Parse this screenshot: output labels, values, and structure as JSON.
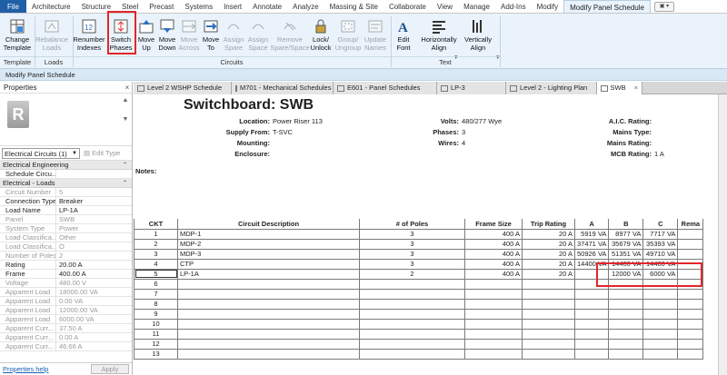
{
  "ribbon_tabs": [
    {
      "label": "File",
      "kind": "file"
    },
    {
      "label": "Architecture"
    },
    {
      "label": "Structure"
    },
    {
      "label": "Steel"
    },
    {
      "label": "Precast"
    },
    {
      "label": "Systems"
    },
    {
      "label": "Insert"
    },
    {
      "label": "Annotate"
    },
    {
      "label": "Analyze"
    },
    {
      "label": "Massing & Site"
    },
    {
      "label": "Collaborate"
    },
    {
      "label": "View"
    },
    {
      "label": "Manage"
    },
    {
      "label": "Add-Ins"
    },
    {
      "label": "Modify"
    },
    {
      "label": "Modify Panel Schedule",
      "kind": "ctx"
    }
  ],
  "tab_switch": "▣ ▾",
  "ribbon": {
    "buttons": [
      {
        "label": "Change\nTemplate",
        "icon": "change-template-icon",
        "enabled": true
      },
      {
        "label": "Rebalance\nLoads",
        "icon": "rebalance-loads-icon",
        "enabled": false
      },
      {
        "label": "Renumber\nIndexes",
        "icon": "renumber-indexes-icon",
        "enabled": true
      },
      {
        "label": "Switch\nPhases",
        "icon": "switch-phases-icon",
        "enabled": true
      },
      {
        "label": "Move\nUp",
        "icon": "move-up-icon",
        "enabled": true
      },
      {
        "label": "Move\nDown",
        "icon": "move-down-icon",
        "enabled": true
      },
      {
        "label": "Move\nAcross",
        "icon": "move-across-icon",
        "enabled": false
      },
      {
        "label": "Move\nTo",
        "icon": "move-to-icon",
        "enabled": true
      },
      {
        "label": "Assign\nSpare",
        "icon": "assign-spare-icon",
        "enabled": false
      },
      {
        "label": "Assign\nSpace",
        "icon": "assign-space-icon",
        "enabled": false
      },
      {
        "label": "Remove\nSpare/Space",
        "icon": "remove-spare-icon",
        "enabled": false
      },
      {
        "label": "Lock/\nUnlock",
        "icon": "lock-icon",
        "enabled": true
      },
      {
        "label": "Group/\nUngroup",
        "icon": "group-icon",
        "enabled": false
      },
      {
        "label": "Update\nNames",
        "icon": "update-names-icon",
        "enabled": false
      },
      {
        "label": "Edit\nFont",
        "icon": "edit-font-icon",
        "enabled": true
      },
      {
        "label": "Horizontally\nAlign",
        "icon": "horizontal-align-icon",
        "enabled": true
      },
      {
        "label": "Vertically\nAlign",
        "icon": "vertical-align-icon",
        "enabled": true
      }
    ],
    "groups": [
      {
        "label": "Template"
      },
      {
        "label": "Loads"
      },
      {
        "label": "Circuits"
      },
      {
        "label": "Text"
      }
    ]
  },
  "context_bar": "Modify Panel Schedule",
  "properties": {
    "title": "Properties",
    "close": "×",
    "type_selector": "Electrical Circuits (1)",
    "edit_type": "Edit Type",
    "categories": [
      {
        "label": "Electrical Engineering",
        "rows": [
          {
            "k": "Schedule Circu...",
            "v": "",
            "box": true
          }
        ]
      },
      {
        "label": "Electrical - Loads",
        "rows": [
          {
            "k": "Circuit Number",
            "v": "5",
            "ro": true
          },
          {
            "k": "Connection Type",
            "v": "Breaker"
          },
          {
            "k": "Load Name",
            "v": "LP-1A"
          },
          {
            "k": "Panel",
            "v": "SWB",
            "ro": true
          },
          {
            "k": "System Type",
            "v": "Power",
            "ro": true
          },
          {
            "k": "Load Classifica...",
            "v": "Other",
            "ro": true
          },
          {
            "k": "Load Classifica...",
            "v": "O",
            "ro": true
          },
          {
            "k": "Number of Poles",
            "v": "2",
            "ro": true
          },
          {
            "k": "Rating",
            "v": "20.00 A"
          },
          {
            "k": "Frame",
            "v": "400.00 A"
          },
          {
            "k": "Voltage",
            "v": "480.00 V",
            "ro": true
          },
          {
            "k": "Apparent Load",
            "v": "18000.00 VA",
            "ro": true
          },
          {
            "k": "Apparent Load",
            "v": "0.00 VA",
            "ro": true
          },
          {
            "k": "Apparent Load",
            "v": "12000.00 VA",
            "ro": true
          },
          {
            "k": "Apparent Load",
            "v": "6000.00 VA",
            "ro": true
          },
          {
            "k": "Apparent Curr...",
            "v": "37.50 A",
            "ro": true
          },
          {
            "k": "Apparent Curr...",
            "v": "0.00 A",
            "ro": true
          },
          {
            "k": "Apparent Curr...",
            "v": "46.66 A",
            "ro": true
          }
        ]
      }
    ],
    "help": "Properties help",
    "apply": "Apply"
  },
  "doc_tabs": [
    {
      "label": "Level 2 WSHP Schedule"
    },
    {
      "label": "M701 - Mechanical Schedules"
    },
    {
      "label": "E601 - Panel Schedules"
    },
    {
      "label": "LP-3"
    },
    {
      "label": "Level 2 - Lighting Plan"
    },
    {
      "label": "SWB",
      "active": true,
      "close": "×"
    }
  ],
  "schedule": {
    "title": "Switchboard: SWB",
    "header": {
      "left": [
        {
          "k": "Location:",
          "v": "Power Riser 113"
        },
        {
          "k": "Supply From:",
          "v": "T-SVC"
        },
        {
          "k": "Mounting:",
          "v": ""
        },
        {
          "k": "Enclosure:",
          "v": ""
        }
      ],
      "mid": [
        {
          "k": "Volts:",
          "v": "480/277 Wye"
        },
        {
          "k": "Phases:",
          "v": "3"
        },
        {
          "k": "Wires:",
          "v": "4"
        }
      ],
      "right": [
        {
          "k": "A.I.C. Rating:",
          "v": ""
        },
        {
          "k": "Mains Type:",
          "v": ""
        },
        {
          "k": "Mains Rating:",
          "v": ""
        },
        {
          "k": "MCB Rating:",
          "v": "1 A"
        }
      ]
    },
    "notes_label": "Notes:",
    "columns": [
      "CKT",
      "Circuit Description",
      "# of Poles",
      "Frame Size",
      "Trip Rating",
      "A",
      "B",
      "C",
      "Rema"
    ],
    "rows": [
      [
        "1",
        "MDP-1",
        "3",
        "400 A",
        "20 A",
        "5919 VA",
        "8977 VA",
        "7717 VA",
        ""
      ],
      [
        "2",
        "MDP-2",
        "3",
        "400 A",
        "20 A",
        "37471 VA",
        "35679 VA",
        "35393 VA",
        ""
      ],
      [
        "3",
        "MDP-3",
        "3",
        "400 A",
        "20 A",
        "50926 VA",
        "51351 VA",
        "49710 VA",
        ""
      ],
      [
        "4",
        "CTP",
        "3",
        "400 A",
        "20 A",
        "14400 VA",
        "14400 VA",
        "14400 VA",
        ""
      ],
      [
        "5",
        "LP-1A",
        "2",
        "400 A",
        "20 A",
        "",
        "12000 VA",
        "6000 VA",
        ""
      ],
      [
        "6",
        "",
        "",
        "",
        "",
        "",
        "",
        "",
        ""
      ],
      [
        "7",
        "",
        "",
        "",
        "",
        "",
        "",
        "",
        ""
      ],
      [
        "8",
        "",
        "",
        "",
        "",
        "",
        "",
        "",
        ""
      ],
      [
        "9",
        "",
        "",
        "",
        "",
        "",
        "",
        "",
        ""
      ],
      [
        "10",
        "",
        "",
        "",
        "",
        "",
        "",
        "",
        ""
      ],
      [
        "11",
        "",
        "",
        "",
        "",
        "",
        "",
        "",
        ""
      ],
      [
        "12",
        "",
        "",
        "",
        "",
        "",
        "",
        "",
        ""
      ],
      [
        "13",
        "",
        "",
        "",
        "",
        "",
        "",
        "",
        ""
      ]
    ]
  },
  "colors": {
    "highlight": "#e2262a",
    "ribbon": "#eaf3fb",
    "file_tab": "#1f5fa6"
  }
}
